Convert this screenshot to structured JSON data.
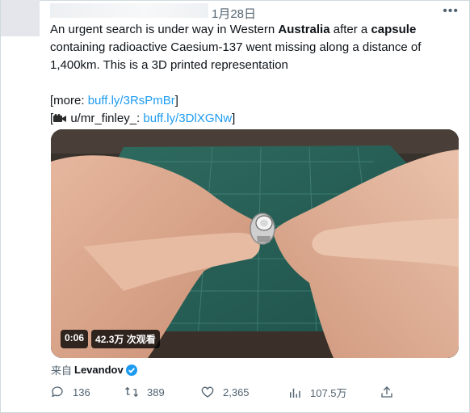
{
  "tweet": {
    "date": "1月28日",
    "more_icon": "more-icon",
    "lines": [
      [
        "An urgent search is under way in Western ",
        "Australia",
        " after a ",
        "capsule"
      ],
      [
        "containing radioactive Caesium-137 went missing along a distance of"
      ],
      [
        "1,400km. This is a 3D printed representation"
      ]
    ],
    "more_prefix": "[more: ",
    "more_link": "buff.ly/3RsPmBr",
    "more_suffix": "]",
    "credit_prefix_open": "[",
    "credit_icon": "video-camera-icon",
    "credit_user": " u/mr_finley_: ",
    "credit_link": "buff.ly/3DlXGNw",
    "credit_suffix": "]"
  },
  "video": {
    "duration": "0:06",
    "views": "42.3万 次观看"
  },
  "source": {
    "prefix": "来自",
    "name": "Levandov",
    "verified_color": "#1d9bf0"
  },
  "actions": {
    "replies": "136",
    "retweets": "389",
    "likes": "2,365",
    "views": "107.5万"
  }
}
